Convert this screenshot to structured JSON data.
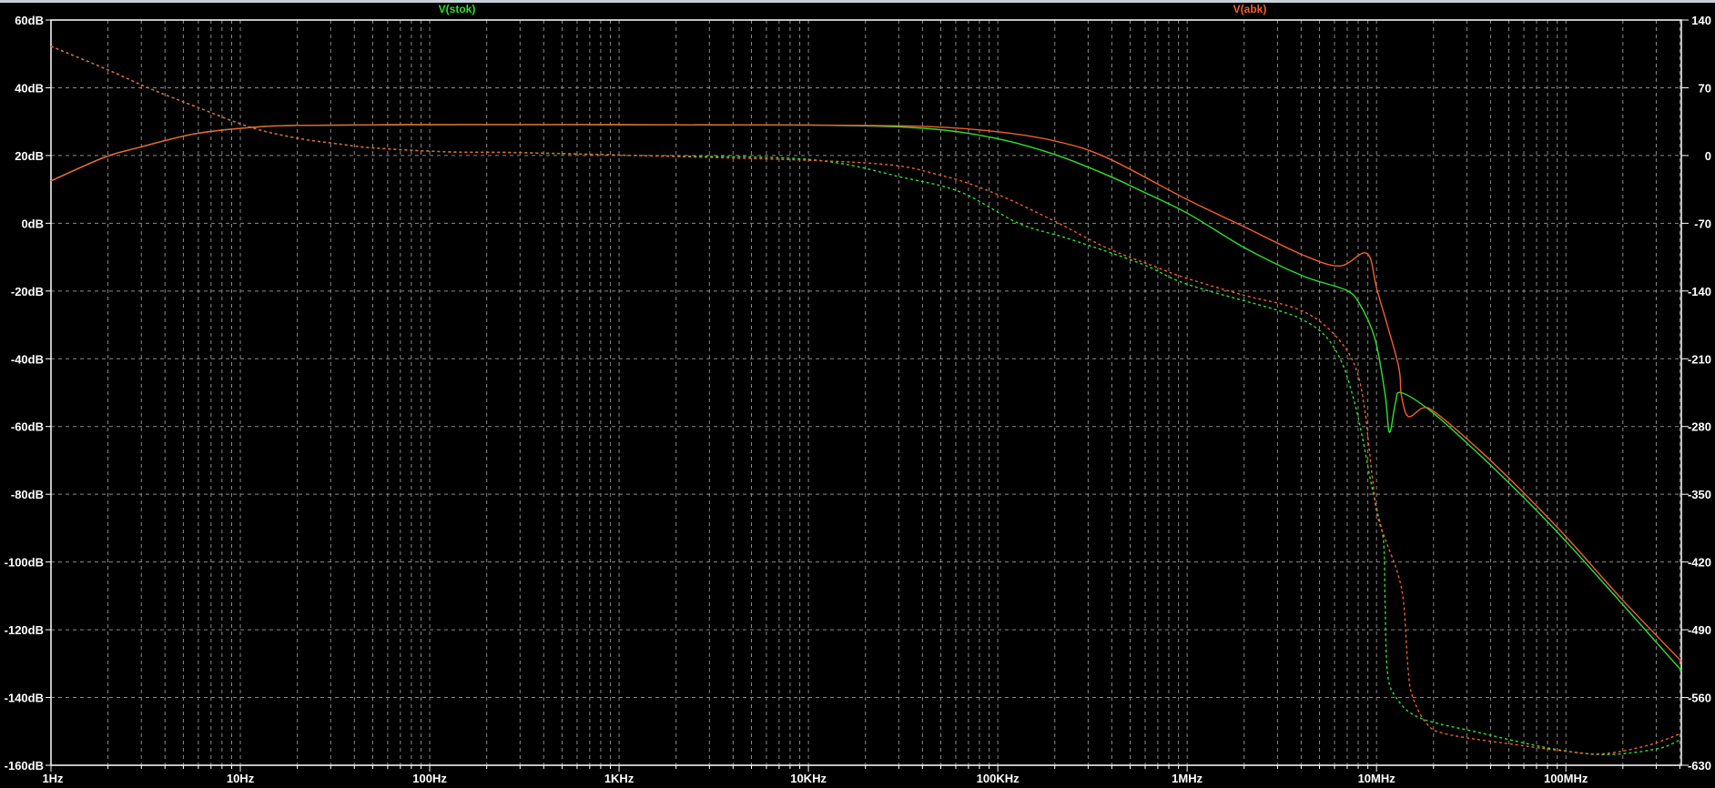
{
  "chart_data": {
    "type": "line",
    "title": "",
    "xlabel": "",
    "ylabel": "",
    "xscale": "log",
    "xlim": [
      1,
      407000000
    ],
    "ylim_left_db": [
      -160,
      60
    ],
    "ylim_right_deg": [
      -630,
      140
    ],
    "grid": true,
    "x_tick_labels": [
      "1Hz",
      "10Hz",
      "100Hz",
      "1KHz",
      "10KHz",
      "100KHz",
      "1MHz",
      "10MHz",
      "100MHz"
    ],
    "x_tick_values": [
      1,
      10,
      100,
      1000,
      10000,
      100000,
      1000000,
      10000000,
      100000000
    ],
    "left_tick_labels": [
      "60dB",
      "40dB",
      "20dB",
      "0dB",
      "-20dB",
      "-40dB",
      "-60dB",
      "-80dB",
      "-100dB",
      "-120dB",
      "-140dB",
      "-160dB"
    ],
    "left_tick_values": [
      60,
      40,
      20,
      0,
      -20,
      -40,
      -60,
      -80,
      -100,
      -120,
      -140,
      -160
    ],
    "right_tick_labels": [
      "140",
      "70",
      "0",
      "-70",
      "-140",
      "-210",
      "-280",
      "-350",
      "-420",
      "-490",
      "-560",
      "-630"
    ],
    "right_tick_values": [
      140,
      70,
      0,
      -70,
      -140,
      -210,
      -280,
      -350,
      -420,
      -490,
      -560,
      -630
    ],
    "legend": [
      {
        "name": "V(stok)",
        "color": "#2fe02f"
      },
      {
        "name": "V(abk)",
        "color": "#f0602c"
      }
    ],
    "series": [
      {
        "name": "V(stok) magnitude",
        "trace": "V(stok)",
        "axis": "left",
        "style": "solid",
        "color": "#2fe02f",
        "points": [
          [
            1,
            12.5
          ],
          [
            1.92,
            19.5
          ],
          [
            2.93,
            22.4
          ],
          [
            5.75,
            26.4
          ],
          [
            11.4,
            28.3
          ],
          [
            20,
            28.9
          ],
          [
            70,
            29.1
          ],
          [
            1000,
            29.1
          ],
          [
            10000,
            29
          ],
          [
            41000,
            28
          ],
          [
            99000,
            25
          ],
          [
            200000,
            20.3
          ],
          [
            372000,
            14.4
          ],
          [
            575000,
            9.5
          ],
          [
            1000000,
            3
          ],
          [
            2050000,
            -7.5
          ],
          [
            4100000,
            -15.6
          ],
          [
            6800000,
            -19.6
          ],
          [
            8100000,
            -23.6
          ],
          [
            9800000,
            -34
          ],
          [
            11100000,
            -50.5
          ],
          [
            11700000,
            -61.7
          ],
          [
            12600000,
            -53
          ],
          [
            13500000,
            -50
          ],
          [
            19500000,
            -55.6
          ],
          [
            33000000,
            -67
          ],
          [
            60000000,
            -81
          ],
          [
            102000000,
            -94.4
          ],
          [
            200000000,
            -112.6
          ],
          [
            407000000,
            -132
          ]
        ]
      },
      {
        "name": "V(abk) magnitude",
        "trace": "V(abk)",
        "axis": "left",
        "style": "solid",
        "color": "#f0602c",
        "points": [
          [
            1,
            12.5
          ],
          [
            1.92,
            19.5
          ],
          [
            2.93,
            22.4
          ],
          [
            5.75,
            26.4
          ],
          [
            11.4,
            28.3
          ],
          [
            20,
            28.9
          ],
          [
            70,
            29.1
          ],
          [
            1000,
            29.1
          ],
          [
            10000,
            29
          ],
          [
            41000,
            28.6
          ],
          [
            100000,
            27
          ],
          [
            200000,
            24.3
          ],
          [
            372000,
            19.5
          ],
          [
            1000000,
            7
          ],
          [
            2050000,
            -1.3
          ],
          [
            4100000,
            -9.4
          ],
          [
            6400000,
            -12.6
          ],
          [
            8900000,
            -8.9
          ],
          [
            10100000,
            -20
          ],
          [
            13000000,
            -41.6
          ],
          [
            13500000,
            -50.5
          ],
          [
            14700000,
            -57
          ],
          [
            17600000,
            -54.5
          ],
          [
            20600000,
            -56
          ],
          [
            35000000,
            -67
          ],
          [
            60000000,
            -79.6
          ],
          [
            102000000,
            -93
          ],
          [
            200000000,
            -111.3
          ],
          [
            407000000,
            -129.3
          ]
        ]
      },
      {
        "name": "V(stok) phase",
        "trace": "V(stok)",
        "axis": "right",
        "style": "dashed",
        "color": "#2fe02f",
        "points": [
          [
            1,
            112.8
          ],
          [
            1.92,
            90
          ],
          [
            3.3,
            69.5
          ],
          [
            5.9,
            50
          ],
          [
            11.4,
            29
          ],
          [
            20,
            18
          ],
          [
            35,
            11.3
          ],
          [
            53,
            7.5
          ],
          [
            125,
            3.8
          ],
          [
            290,
            3
          ],
          [
            1250,
            0
          ],
          [
            10000,
            -4
          ],
          [
            32000,
            -23
          ],
          [
            64000,
            -38
          ],
          [
            129000,
            -70
          ],
          [
            237000,
            -86
          ],
          [
            575000,
            -112
          ],
          [
            1000000,
            -133
          ],
          [
            2900000,
            -159
          ],
          [
            4100000,
            -170
          ],
          [
            5400000,
            -187
          ],
          [
            6600000,
            -215
          ],
          [
            7600000,
            -253
          ],
          [
            8400000,
            -290
          ],
          [
            9200000,
            -331
          ],
          [
            10100000,
            -368
          ],
          [
            10900000,
            -400
          ],
          [
            11100000,
            -462
          ],
          [
            11400000,
            -532
          ],
          [
            12600000,
            -559
          ],
          [
            16900000,
            -581
          ],
          [
            36200000,
            -597
          ],
          [
            85000000,
            -613
          ],
          [
            161000000,
            -619
          ],
          [
            304000000,
            -613
          ],
          [
            407000000,
            -603
          ]
        ]
      },
      {
        "name": "V(abk) phase",
        "trace": "V(abk)",
        "axis": "right",
        "style": "dashed",
        "color": "#f0602c",
        "points": [
          [
            1,
            112.8
          ],
          [
            1.92,
            90
          ],
          [
            3.3,
            69.5
          ],
          [
            5.9,
            50
          ],
          [
            11.4,
            29
          ],
          [
            20,
            18
          ],
          [
            35,
            11.3
          ],
          [
            53,
            7.5
          ],
          [
            125,
            3.8
          ],
          [
            290,
            3
          ],
          [
            1250,
            0
          ],
          [
            19600,
            -7.5
          ],
          [
            49000,
            -20
          ],
          [
            99000,
            -40
          ],
          [
            200000,
            -68
          ],
          [
            372000,
            -95
          ],
          [
            680000,
            -115
          ],
          [
            1000000,
            -127
          ],
          [
            2050000,
            -145
          ],
          [
            3500000,
            -156
          ],
          [
            5000000,
            -171
          ],
          [
            6800000,
            -198
          ],
          [
            8000000,
            -227
          ],
          [
            8700000,
            -265
          ],
          [
            9000000,
            -290
          ],
          [
            9600000,
            -340
          ],
          [
            10100000,
            -372
          ],
          [
            11300000,
            -400
          ],
          [
            12900000,
            -431
          ],
          [
            13900000,
            -462
          ],
          [
            14700000,
            -532
          ],
          [
            15500000,
            -559
          ],
          [
            18400000,
            -587
          ],
          [
            23700000,
            -598
          ],
          [
            55600000,
            -609
          ],
          [
            105000000,
            -616
          ],
          [
            161000000,
            -618
          ],
          [
            276000000,
            -609
          ],
          [
            407000000,
            -597
          ]
        ]
      }
    ]
  }
}
